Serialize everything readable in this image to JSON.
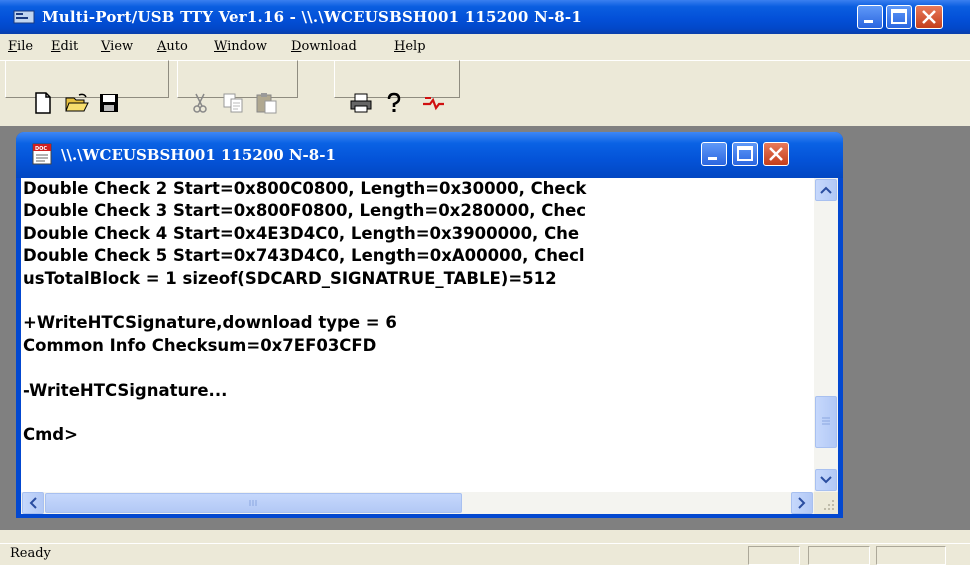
{
  "main_window": {
    "title": "Multi-Port/USB TTY Ver1.16 - \\\\.\\WCEUSBSH001 115200  N-8-1"
  },
  "menu": [
    {
      "label": "File",
      "accel": "F",
      "rest": "ile"
    },
    {
      "label": "Edit",
      "accel": "E",
      "rest": "dit"
    },
    {
      "label": "View",
      "accel": "V",
      "rest": "iew"
    },
    {
      "label": "Auto",
      "accel": "A",
      "rest": "uto"
    },
    {
      "label": "Window",
      "accel": "W",
      "rest": "indow"
    },
    {
      "label": "Download",
      "accel": "D",
      "rest": "ownload"
    },
    {
      "label": "Help",
      "accel": "H",
      "rest": "elp"
    }
  ],
  "toolbar": [
    {
      "icon": "new-document-icon"
    },
    {
      "icon": "open-folder-icon"
    },
    {
      "icon": "save-icon"
    },
    {
      "icon": "cut-icon"
    },
    {
      "icon": "copy-icon"
    },
    {
      "icon": "paste-icon"
    },
    {
      "icon": "print-icon"
    },
    {
      "icon": "help-icon"
    },
    {
      "icon": "connect-icon"
    }
  ],
  "child_window": {
    "title": "\\\\.\\WCEUSBSH001 115200  N-8-1"
  },
  "terminal": {
    "lines": [
      "Double Check 2 Start=0x800C0800, Length=0x30000, Check",
      "Double Check 3 Start=0x800F0800, Length=0x280000, Chec",
      "Double Check 4 Start=0x4E3D4C0, Length=0x3900000, Che",
      "Double Check 5 Start=0x743D4C0, Length=0xA00000, Checl",
      "usTotalBlock = 1 sizeof(SDCARD_SIGNATRUE_TABLE)=512",
      "",
      "+WriteHTCSignature,download type = 6",
      "Common Info Checksum=0x7EF03CFD",
      "",
      "-WriteHTCSignature...",
      "",
      "Cmd>"
    ]
  },
  "scrollbar": {
    "vertical_position": 0.92,
    "horizontal_position": 0.0
  },
  "status": {
    "text": "Ready"
  }
}
